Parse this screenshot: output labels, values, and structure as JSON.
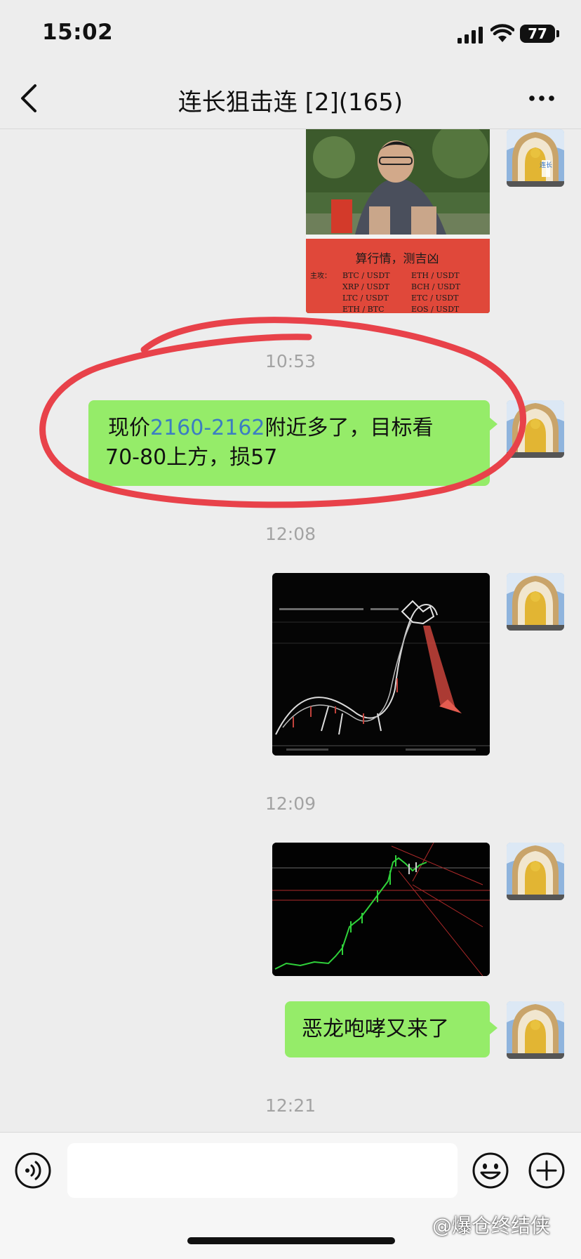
{
  "status_bar": {
    "time": "15:02",
    "battery": "77"
  },
  "header": {
    "title": "连长狙击连 [2](165)"
  },
  "messages": [
    {
      "type": "image",
      "sign_title": "算行情，测吉凶",
      "sign_prefix": "主攻：",
      "sign_pairs": [
        "BTC / USDT",
        "ETH / USDT",
        "XRP / USDT",
        "BCH / USDT",
        "LTC / USDT",
        "ETC / USDT",
        "ETH / BTC",
        "EOS / USDT"
      ]
    },
    {
      "type": "time",
      "text": "10:53"
    },
    {
      "type": "text",
      "pre": "现价",
      "highlight": "2160-2162",
      "post": "附近多了，目标看",
      "line2": "70-80上方，损57"
    },
    {
      "type": "time",
      "text": "12:08"
    },
    {
      "type": "image",
      "description": "dragon-chart"
    },
    {
      "type": "time",
      "text": "12:09"
    },
    {
      "type": "image",
      "description": "candle-chart"
    },
    {
      "type": "text",
      "text": "恶龙咆哮又来了"
    },
    {
      "type": "time",
      "text": "12:21"
    }
  ],
  "avatar": {
    "label": "连长"
  },
  "watermark": "@爆仓终结侠",
  "colors": {
    "bubble": "#95ec69",
    "highlight": "#3b7dc2",
    "circle": "#e8424a"
  }
}
